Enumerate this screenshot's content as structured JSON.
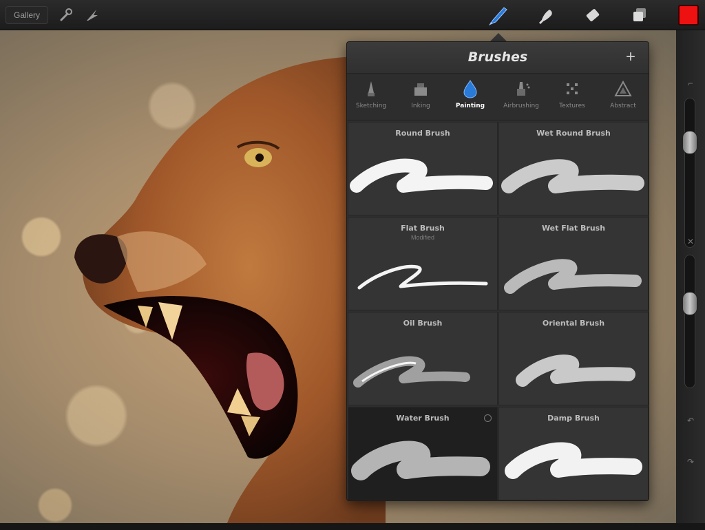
{
  "toolbar": {
    "gallery_label": "Gallery",
    "tools": [
      {
        "name": "adjustments-icon"
      },
      {
        "name": "transform-icon"
      },
      {
        "name": "brush-icon",
        "active": true
      },
      {
        "name": "smudge-icon"
      },
      {
        "name": "eraser-icon"
      },
      {
        "name": "layers-icon"
      }
    ],
    "current_color": "#ee1111"
  },
  "brushes_panel": {
    "title": "Brushes",
    "add_label": "+",
    "categories": [
      {
        "label": "Sketching",
        "icon": "pencil-icon"
      },
      {
        "label": "Inking",
        "icon": "ink-icon"
      },
      {
        "label": "Painting",
        "icon": "drop-icon",
        "active": true
      },
      {
        "label": "Airbrushing",
        "icon": "airbrush-icon"
      },
      {
        "label": "Textures",
        "icon": "texture-icon"
      },
      {
        "label": "Abstract",
        "icon": "abstract-icon"
      }
    ],
    "brushes": [
      {
        "name": "Round Brush",
        "subtitle": ""
      },
      {
        "name": "Wet Round Brush",
        "subtitle": ""
      },
      {
        "name": "Flat Brush",
        "subtitle": "Modified"
      },
      {
        "name": "Wet Flat Brush",
        "subtitle": ""
      },
      {
        "name": "Oil Brush",
        "subtitle": ""
      },
      {
        "name": "Oriental Brush",
        "subtitle": ""
      },
      {
        "name": "Water Brush",
        "subtitle": "",
        "selected": true
      },
      {
        "name": "Damp Brush",
        "subtitle": ""
      }
    ]
  },
  "accent_color": "#2a7ad8"
}
